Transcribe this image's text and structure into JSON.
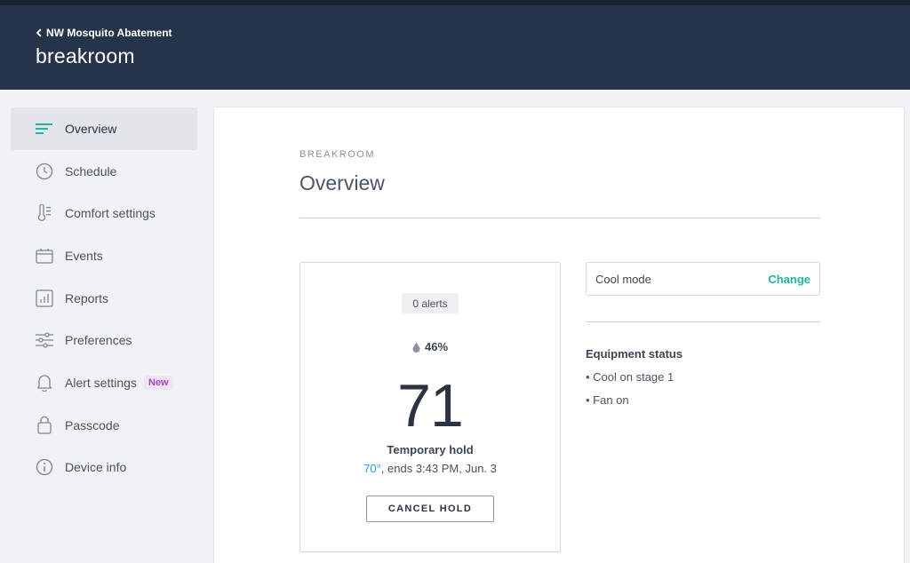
{
  "header": {
    "back_label": "NW Mosquito Abatement",
    "title": "breakroom"
  },
  "sidebar": {
    "items": [
      {
        "label": "Overview",
        "icon": "list-lines-icon"
      },
      {
        "label": "Schedule",
        "icon": "clock-icon"
      },
      {
        "label": "Comfort settings",
        "icon": "thermometer-icon"
      },
      {
        "label": "Events",
        "icon": "calendar-icon"
      },
      {
        "label": "Reports",
        "icon": "bar-chart-icon"
      },
      {
        "label": "Preferences",
        "icon": "sliders-icon"
      },
      {
        "label": "Alert settings",
        "icon": "bell-icon",
        "badge": "New"
      },
      {
        "label": "Passcode",
        "icon": "lock-icon"
      },
      {
        "label": "Device info",
        "icon": "info-icon"
      }
    ]
  },
  "main": {
    "eyebrow": "BREAKROOM",
    "title": "Overview"
  },
  "thermostat": {
    "alerts": "0 alerts",
    "humidity": "46%",
    "temperature": "71",
    "hold_label": "Temporary hold",
    "hold_temp": "70°",
    "hold_until": ", ends 3:43 PM, Jun. 3",
    "cancel_label": "CANCEL HOLD"
  },
  "mode": {
    "label": "Cool mode",
    "change_label": "Change"
  },
  "equipment": {
    "title": "Equipment status",
    "items": [
      "• Cool on stage 1",
      "• Fan on"
    ]
  },
  "colors": {
    "header_bg": "#26344a",
    "accent_teal": "#22b5a2",
    "accent_blue": "#2a9ad6",
    "badge_purple": "#a247b8"
  }
}
